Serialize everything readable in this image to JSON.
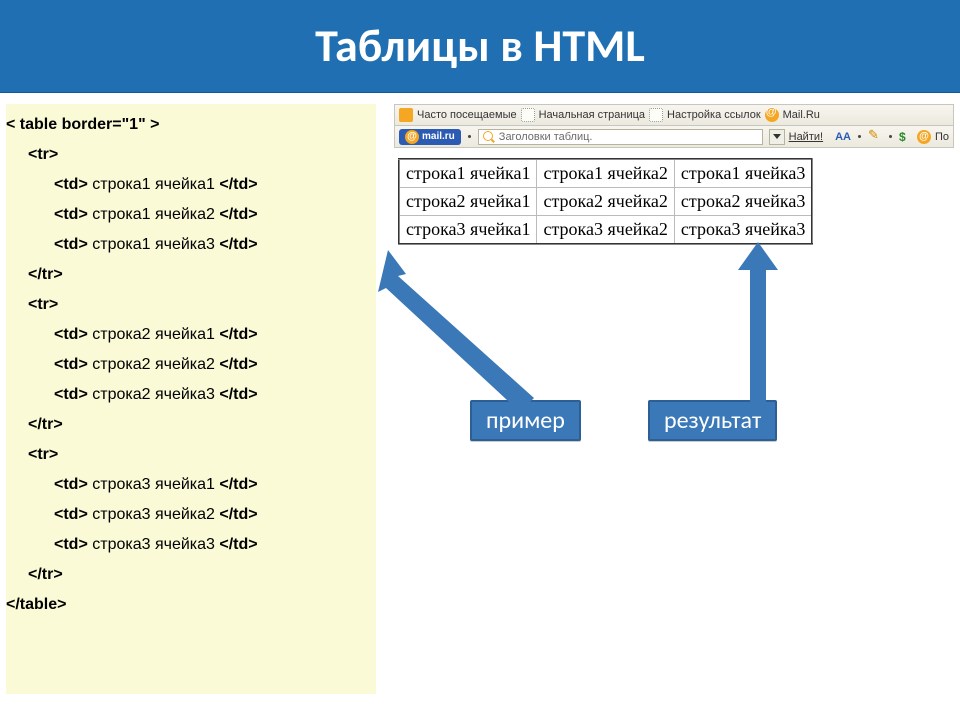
{
  "slide_title": "Таблицы в HTML",
  "code": {
    "open_table": "< table border=\"1\" >",
    "tr_open": "<tr>",
    "tr_close": "</tr>",
    "close_table": "</table>",
    "rows": [
      [
        "<td> строка1 ячейка1 </td>",
        "<td> строка1 ячейка2 </td>",
        "<td> строка1 ячейка3 </td>"
      ],
      [
        "<td> строка2 ячейка1 </td>",
        "<td> строка2 ячейка2 </td>",
        "<td> строка2 ячейка3 </td>"
      ],
      [
        "<td> строка3 ячейка1 </td>",
        "<td> строка3 ячейка2 </td>",
        "<td> строка3 ячейка3 </td>"
      ]
    ]
  },
  "browser": {
    "bookmarks": {
      "frequent": "Часто посещаемые",
      "home": "Начальная страница",
      "links": "Настройка ссылок",
      "mailru": "Mail.Ru"
    },
    "search_placeholder": "Заголовки таблиц.",
    "go_label": "Найти!",
    "aa_label": "AA",
    "mail_logo": "mail.ru",
    "po_cut": "По"
  },
  "result_table": [
    [
      "строка1 ячейка1",
      "строка1 ячейка2",
      "строка1 ячейка3"
    ],
    [
      "строка2 ячейка1",
      "строка2 ячейка2",
      "строка2 ячейка3"
    ],
    [
      "строка3 ячейка1",
      "строка3 ячейка2",
      "строка3 ячейка3"
    ]
  ],
  "labels": {
    "example": "пример",
    "result": "результат"
  }
}
